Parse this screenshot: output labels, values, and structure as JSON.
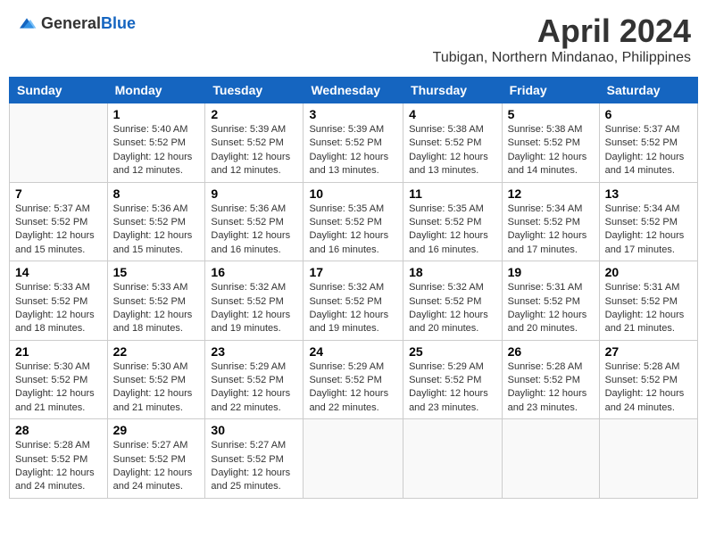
{
  "logo": {
    "general": "General",
    "blue": "Blue"
  },
  "title": "April 2024",
  "location": "Tubigan, Northern Mindanao, Philippines",
  "days_of_week": [
    "Sunday",
    "Monday",
    "Tuesday",
    "Wednesday",
    "Thursday",
    "Friday",
    "Saturday"
  ],
  "weeks": [
    [
      {
        "day": "",
        "info": ""
      },
      {
        "day": "1",
        "info": "Sunrise: 5:40 AM\nSunset: 5:52 PM\nDaylight: 12 hours\nand 12 minutes."
      },
      {
        "day": "2",
        "info": "Sunrise: 5:39 AM\nSunset: 5:52 PM\nDaylight: 12 hours\nand 12 minutes."
      },
      {
        "day": "3",
        "info": "Sunrise: 5:39 AM\nSunset: 5:52 PM\nDaylight: 12 hours\nand 13 minutes."
      },
      {
        "day": "4",
        "info": "Sunrise: 5:38 AM\nSunset: 5:52 PM\nDaylight: 12 hours\nand 13 minutes."
      },
      {
        "day": "5",
        "info": "Sunrise: 5:38 AM\nSunset: 5:52 PM\nDaylight: 12 hours\nand 14 minutes."
      },
      {
        "day": "6",
        "info": "Sunrise: 5:37 AM\nSunset: 5:52 PM\nDaylight: 12 hours\nand 14 minutes."
      }
    ],
    [
      {
        "day": "7",
        "info": "Sunrise: 5:37 AM\nSunset: 5:52 PM\nDaylight: 12 hours\nand 15 minutes."
      },
      {
        "day": "8",
        "info": "Sunrise: 5:36 AM\nSunset: 5:52 PM\nDaylight: 12 hours\nand 15 minutes."
      },
      {
        "day": "9",
        "info": "Sunrise: 5:36 AM\nSunset: 5:52 PM\nDaylight: 12 hours\nand 16 minutes."
      },
      {
        "day": "10",
        "info": "Sunrise: 5:35 AM\nSunset: 5:52 PM\nDaylight: 12 hours\nand 16 minutes."
      },
      {
        "day": "11",
        "info": "Sunrise: 5:35 AM\nSunset: 5:52 PM\nDaylight: 12 hours\nand 16 minutes."
      },
      {
        "day": "12",
        "info": "Sunrise: 5:34 AM\nSunset: 5:52 PM\nDaylight: 12 hours\nand 17 minutes."
      },
      {
        "day": "13",
        "info": "Sunrise: 5:34 AM\nSunset: 5:52 PM\nDaylight: 12 hours\nand 17 minutes."
      }
    ],
    [
      {
        "day": "14",
        "info": "Sunrise: 5:33 AM\nSunset: 5:52 PM\nDaylight: 12 hours\nand 18 minutes."
      },
      {
        "day": "15",
        "info": "Sunrise: 5:33 AM\nSunset: 5:52 PM\nDaylight: 12 hours\nand 18 minutes."
      },
      {
        "day": "16",
        "info": "Sunrise: 5:32 AM\nSunset: 5:52 PM\nDaylight: 12 hours\nand 19 minutes."
      },
      {
        "day": "17",
        "info": "Sunrise: 5:32 AM\nSunset: 5:52 PM\nDaylight: 12 hours\nand 19 minutes."
      },
      {
        "day": "18",
        "info": "Sunrise: 5:32 AM\nSunset: 5:52 PM\nDaylight: 12 hours\nand 20 minutes."
      },
      {
        "day": "19",
        "info": "Sunrise: 5:31 AM\nSunset: 5:52 PM\nDaylight: 12 hours\nand 20 minutes."
      },
      {
        "day": "20",
        "info": "Sunrise: 5:31 AM\nSunset: 5:52 PM\nDaylight: 12 hours\nand 21 minutes."
      }
    ],
    [
      {
        "day": "21",
        "info": "Sunrise: 5:30 AM\nSunset: 5:52 PM\nDaylight: 12 hours\nand 21 minutes."
      },
      {
        "day": "22",
        "info": "Sunrise: 5:30 AM\nSunset: 5:52 PM\nDaylight: 12 hours\nand 21 minutes."
      },
      {
        "day": "23",
        "info": "Sunrise: 5:29 AM\nSunset: 5:52 PM\nDaylight: 12 hours\nand 22 minutes."
      },
      {
        "day": "24",
        "info": "Sunrise: 5:29 AM\nSunset: 5:52 PM\nDaylight: 12 hours\nand 22 minutes."
      },
      {
        "day": "25",
        "info": "Sunrise: 5:29 AM\nSunset: 5:52 PM\nDaylight: 12 hours\nand 23 minutes."
      },
      {
        "day": "26",
        "info": "Sunrise: 5:28 AM\nSunset: 5:52 PM\nDaylight: 12 hours\nand 23 minutes."
      },
      {
        "day": "27",
        "info": "Sunrise: 5:28 AM\nSunset: 5:52 PM\nDaylight: 12 hours\nand 24 minutes."
      }
    ],
    [
      {
        "day": "28",
        "info": "Sunrise: 5:28 AM\nSunset: 5:52 PM\nDaylight: 12 hours\nand 24 minutes."
      },
      {
        "day": "29",
        "info": "Sunrise: 5:27 AM\nSunset: 5:52 PM\nDaylight: 12 hours\nand 24 minutes."
      },
      {
        "day": "30",
        "info": "Sunrise: 5:27 AM\nSunset: 5:52 PM\nDaylight: 12 hours\nand 25 minutes."
      },
      {
        "day": "",
        "info": ""
      },
      {
        "day": "",
        "info": ""
      },
      {
        "day": "",
        "info": ""
      },
      {
        "day": "",
        "info": ""
      }
    ]
  ]
}
